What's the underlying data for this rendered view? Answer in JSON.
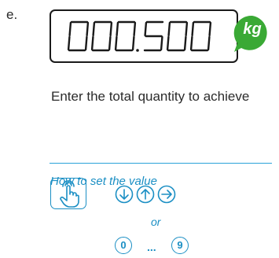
{
  "step_letter": "e.",
  "display": {
    "value": "000.500",
    "unit": "kg",
    "unit_bubble_color": "#3aa935"
  },
  "instruction": "Enter the total quantity to achieve",
  "howto": {
    "label": "How to set the value",
    "accent_color": "#1b8fc4",
    "touch_icon": "hand-touch-icon",
    "arrow_keys": [
      "arrow-down-icon",
      "arrow-up-icon",
      "arrow-right-icon"
    ],
    "or_label": "or",
    "digit_first": "0",
    "digit_ellipsis": "...",
    "digit_last": "9"
  }
}
